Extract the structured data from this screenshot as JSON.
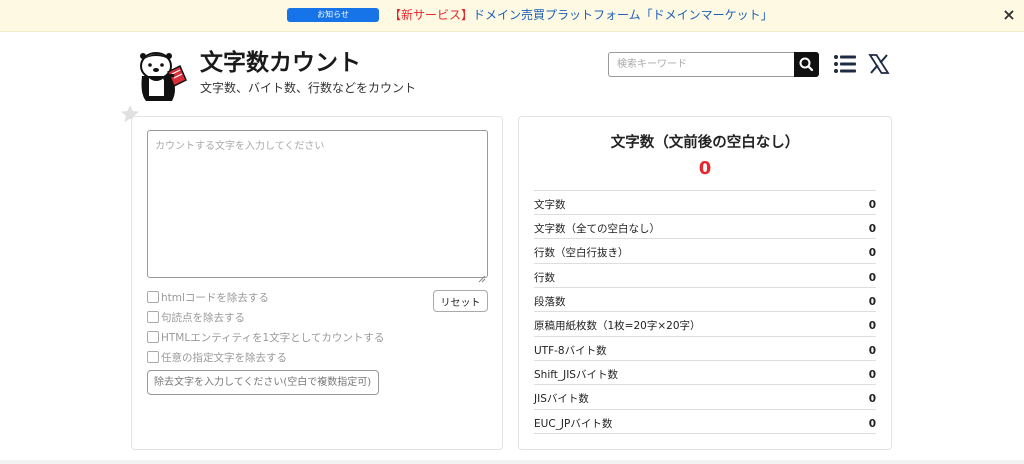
{
  "notice": {
    "badge": "お知らせ",
    "highlight": "【新サービス】",
    "link_text": "ドメイン売買プラットフォーム「ドメインマーケット」",
    "close_label": "×"
  },
  "header": {
    "title": "文字数カウント",
    "subtitle": "文字数、バイト数、行数などをカウント",
    "search_placeholder": "検索キーワード"
  },
  "input_panel": {
    "textarea_placeholder": "カウントする文字を入力してください",
    "options": [
      {
        "label": "htmlコードを除去する",
        "checked": false
      },
      {
        "label": "句読点を除去する",
        "checked": false
      },
      {
        "label": "HTMLエンティティを1文字としてカウントする",
        "checked": false
      },
      {
        "label": "任意の指定文字を除去する",
        "checked": false
      }
    ],
    "reset_label": "リセット",
    "remove_placeholder": "除去文字を入力してください(空白で複数指定可)"
  },
  "result_panel": {
    "main_label": "文字数（文前後の空白なし）",
    "main_value": "0",
    "stats": [
      {
        "label": "文字数",
        "value": "0"
      },
      {
        "label": "文字数（全ての空白なし）",
        "value": "0"
      },
      {
        "label": "行数（空白行抜き）",
        "value": "0"
      },
      {
        "label": "行数",
        "value": "0"
      },
      {
        "label": "段落数",
        "value": "0"
      },
      {
        "label": "原稿用紙枚数（1枚=20字×20字）",
        "value": "0"
      },
      {
        "label": "UTF-8バイト数",
        "value": "0"
      },
      {
        "label": "Shift_JISバイト数",
        "value": "0"
      },
      {
        "label": "JISバイト数",
        "value": "0"
      },
      {
        "label": "EUC_JPバイト数",
        "value": "0"
      }
    ]
  },
  "icons": {
    "logo": "otter-mascot-logo",
    "favorite": "star-icon",
    "search": "search-icon",
    "menu": "menu-icon",
    "social": "x-icon"
  },
  "colors": {
    "notice_bg": "#fdf9e2",
    "badge": "#1773e8",
    "highlight": "#e8262e",
    "link": "#1f5fb8",
    "accent_value": "#e8262e"
  }
}
